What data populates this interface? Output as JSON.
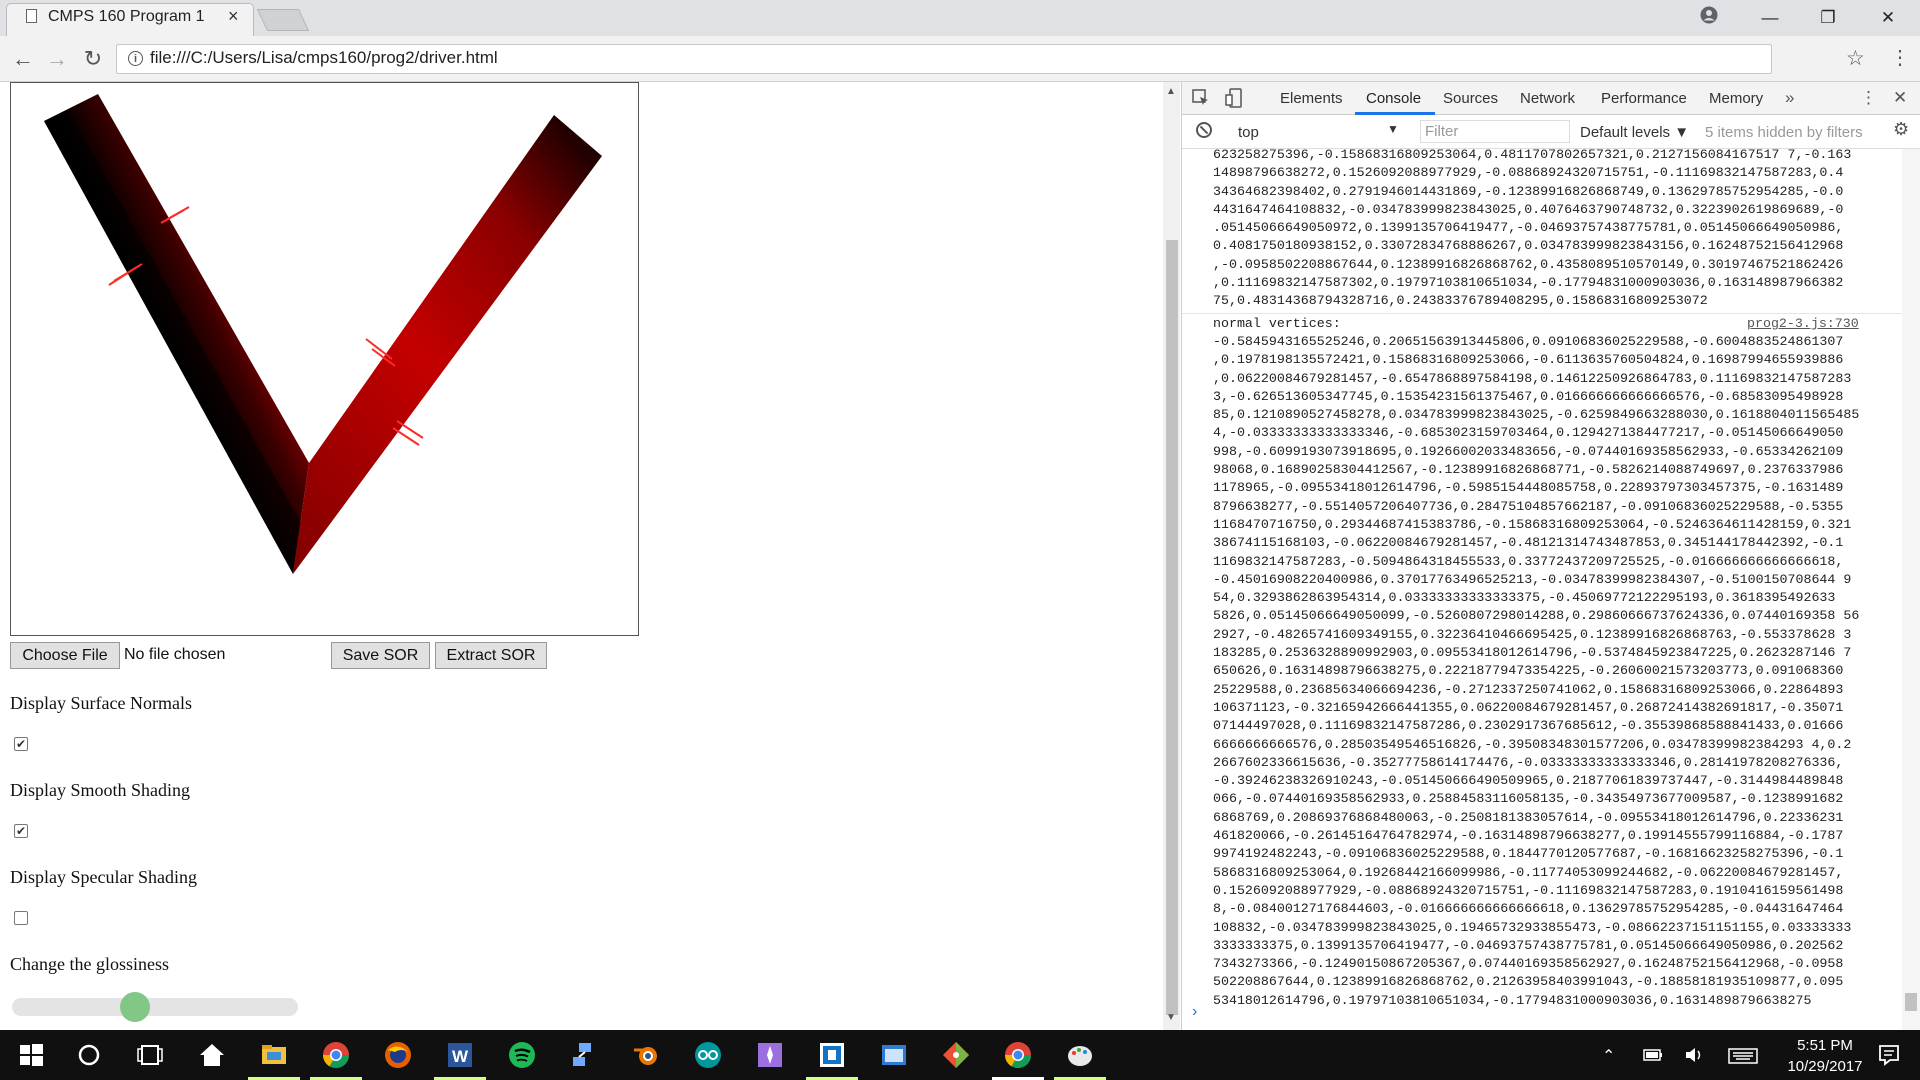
{
  "browser": {
    "tab_title": "CMPS 160 Program 1",
    "tab_close": "×",
    "url": "file:///C:/Users/Lisa/cmps160/prog2/driver.html",
    "window_min": "—",
    "window_restore": "❐",
    "window_close": "✕",
    "nav_back": "←",
    "nav_forward": "→",
    "nav_reload": "↻",
    "star": "☆",
    "menu": "⋮",
    "info": "i"
  },
  "page": {
    "choose_file_label": "Choose File",
    "no_file_text": "No file chosen",
    "save_label": "Save SOR",
    "extract_label": "Extract SOR",
    "normals_label": "Display Surface Normals",
    "normals_checked": true,
    "smooth_label": "Display Smooth Shading",
    "smooth_checked": true,
    "specular_label": "Display Specular Shading",
    "specular_checked": false,
    "gloss_label": "Change the glossiness",
    "gloss_value": 0.42,
    "check_mark": "✔"
  },
  "devtools": {
    "tabs": [
      "Elements",
      "Console",
      "Sources",
      "Network",
      "Performance",
      "Memory"
    ],
    "more_tabs": "»",
    "context": "top",
    "filter_placeholder": "Filter",
    "levels": "Default levels ▼",
    "hidden": "5 items hidden by filters",
    "log1": "623258275396,-0.15868316809253064,0.4811707802657321,0.2127156084167517 7,-0.163\n14898796638272,0.1526092088977929,-0.08868924320715751,-0.11169832147587283,0.4\n34364682398402,0.2791946014431869,-0.12389916826868749,0.13629785752954285,-0.0\n4431647464108832,-0.034783999823843025,0.4076463790748732,0.3223902619869689,-0\n.05145066649050972,0.1399135706419477,-0.04693757438775781,0.05145066649050986,\n0.4081750180938152,0.33072834768886267,0.034783999823843156,0.16248752156412968\n,-0.0958502208867644,0.12389916826868762,0.4358089510570149,0.30197467521862426\n,0.11169832147587302,0.19797103810651034,-0.17794831000903036,0.163148987966382\n75,0.48314368794328716,0.24383376789408295,0.15868316809253072",
    "log2_label": "normal vertices:",
    "log2_source": "prog2-3.js:730",
    "log2": "-0.5845943165525246,0.20651563913445806,0.09106836025229588,-0.6004883524861307\n,0.1978198135572421,0.15868316809253066,-0.6113635760504824,0.16987994655939886\n,0.06220084679281457,-0.6547868897584198,0.14612250926864783,0.11169832147587283\n3,-0.626513605347745,0.15354231561375467,0.016666666666666576,-0.68583095498928\n85,0.1210890527458278,0.034783999823843025,-0.6259849663288030,0.1618804011565485\n4,-0.03333333333333346,-0.6853023159703464,0.1294271384477217,-0.05145066649050\n998,-0.6099193073918695,0.19266002033483656,-0.07440169358562933,-0.65334262109\n98068,0.16890258304412567,-0.12389916826868771,-0.5826214088749697,0.2376337986\n1178965,-0.09553418012614796,-0.5985154448085758,0.22893797303457375,-0.1631489\n8796638277,-0.5514057206407736,0.28475104857662187,-0.09106836025229588,-0.5355\n1168470716750,0.29344687415383786,-0.15868316809253064,-0.5246364611428159,0.321\n38674115168103,-0.06220084679281457,-0.48121314743487853,0.345144178442392,-0.1\n1169832147587283,-0.5094864318455533,0.33772437209725525,-0.016666666666666618,\n-0.45016908220400986,0.37017763496525213,-0.03478399982384307,-0.5100150708644 9\n54,0.3293862863954314,0.03333333333333375,-0.45069772122295193,0.3618395492633\n5826,0.05145066649050099,-0.5260807298014288,0.29860666737624336,0.07440169358 56\n2927,-0.48265741609349155,0.32236410466695425,0.12389916826868763,-0.553378628 3\n183285,0.2536328890992903,0.09553418012614796,-0.5374845923847225,0.2623287146 7\n650626,0.16314898796638275,0.22218779473354225,-0.26060021573203773,0.091068360\n25229588,0.23685634066694236,-0.2712337250741062,0.15868316809253066,0.22864893\n106371123,-0.32165942666441355,0.06220084679281457,0.26872414382691817,-0.35071\n07144497028,0.11169832147587286,0.2302917367685612,-0.35539868588841433,0.01666\n6666666666576,0.28503549546516826,-0.39508348301577206,0.03478399982384293 4,0.2\n2667602336615636,-0.35277758614174476,-0.03333333333333346,0.28141978208276336,\n-0.39246238326910243,-0.051450666490509965,0.21877061839737447,-0.3144984489848\n066,-0.07440169358562933,0.25884583116058135,-0.34354973677009587,-0.1238991682\n6868769,0.20869376868480063,-0.2508181383057614,-0.09553418012614796,0.22336231\n461820066,-0.26145164764782974,-0.16314898796638277,0.19914555799116884,-0.1787\n9974192482243,-0.09106836025229588,0.1844770120577687,-0.16816623258275396,-0.1\n5868316809253064,0.19268442166099986,-0.11774053099244682,-0.06220084679281457,\n0.1526092088977929,-0.08868924320715751,-0.11169832147587283,0.1910416159561498\n8,-0.08400127176844603,-0.016666666666666618,0.13629785752954285,-0.04431647464\n108832,-0.034783999823843025,0.19465732933855473,-0.08662237151151155,0.03333333\n3333333375,0.1399135706419477,-0.04693757438775781,0.05145066649050986,0.202562\n7343273366,-0.12490150867205367,0.07440169358562927,0.16248752156412968,-0.0958\n502208867644,0.12389916826868762,0.21263958403991043,-0.18858181935109877,0.095\n53418012614796,0.19797103810651034,-0.17794831000903036,0.16314898796638275",
    "prompt": "›"
  },
  "taskbar": {
    "time": "5:51 PM",
    "date": "10/29/2017",
    "up_arrow": "⌃"
  }
}
